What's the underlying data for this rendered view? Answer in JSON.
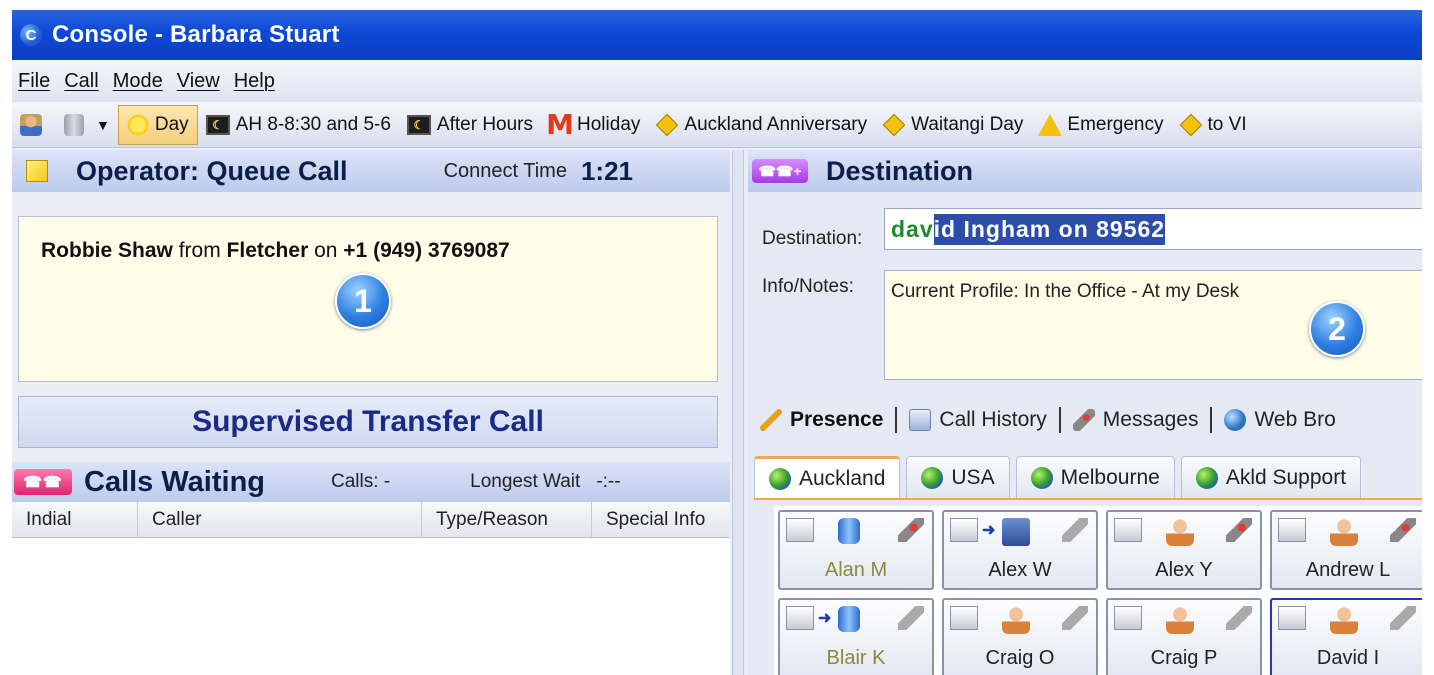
{
  "window": {
    "title": "Console - Barbara Stuart"
  },
  "menu": [
    "File",
    "Call",
    "Mode",
    "View",
    "Help"
  ],
  "toolbar": {
    "modes": [
      {
        "label": "Day",
        "icon": "sun-icon",
        "active": true
      },
      {
        "label": "AH 8-8:30 and 5-6",
        "icon": "monitor-icon"
      },
      {
        "label": "After Hours",
        "icon": "monitor-icon"
      },
      {
        "label": "Holiday",
        "icon": "m-icon"
      },
      {
        "label": "Auckland Anniversary",
        "icon": "diamond-icon"
      },
      {
        "label": "Waitangi Day",
        "icon": "diamond-icon"
      },
      {
        "label": "Emergency",
        "icon": "warning-icon"
      },
      {
        "label": "to VI",
        "icon": "diamond-icon"
      }
    ]
  },
  "operator": {
    "title": "Operator: Queue Call",
    "connect_label": "Connect Time",
    "connect_time": "1:21",
    "caller_name": "Robbie Shaw",
    "from_word": "from",
    "company": "Fletcher",
    "on_word": "on",
    "phone": "+1 (949) 3769087",
    "badge": "1",
    "transfer_button": "Supervised Transfer Call"
  },
  "calls_waiting": {
    "title": "Calls Waiting",
    "calls_label": "Calls: -",
    "longest_label": "Longest Wait",
    "longest_value": "-:--",
    "columns": [
      "Indial",
      "Caller",
      "Type/Reason",
      "Special Info"
    ]
  },
  "destination": {
    "title": "Destination",
    "dest_label": "Destination:",
    "typed": "dav",
    "selected": "id Ingham on 89562",
    "notes_label": "Info/Notes:",
    "notes": "Current Profile: In the Office - At my Desk",
    "badge": "2"
  },
  "panel_tabs": [
    "Presence",
    "Call History",
    "Messages",
    "Web Bro"
  ],
  "location_tabs": [
    "Auckland",
    "USA",
    "Melbourne",
    "Akld Support"
  ],
  "people": [
    {
      "name": "Alan M",
      "dim": true
    },
    {
      "name": "Alex W",
      "dim": false
    },
    {
      "name": "Alex Y",
      "dim": false
    },
    {
      "name": "Andrew L",
      "dim": false
    },
    {
      "name": "Blair K",
      "dim": true
    },
    {
      "name": "Craig O",
      "dim": false
    },
    {
      "name": "Craig P",
      "dim": false
    },
    {
      "name": "David I",
      "dim": false,
      "selected": true
    }
  ]
}
